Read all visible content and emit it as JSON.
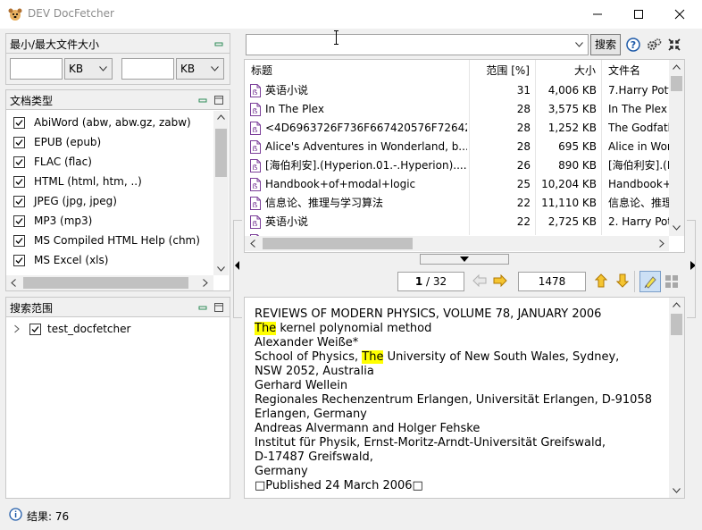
{
  "window": {
    "title": "DEV DocFetcher",
    "icon": "dog-icon"
  },
  "size_panel": {
    "title": "最小/最大文件大小",
    "min_value": "",
    "min_unit": "KB",
    "max_value": "",
    "max_unit": "KB"
  },
  "doctype_panel": {
    "title": "文档类型",
    "items": [
      {
        "label": "AbiWord (abw, abw.gz, zabw)",
        "checked": true
      },
      {
        "label": "EPUB (epub)",
        "checked": true
      },
      {
        "label": "FLAC (flac)",
        "checked": true
      },
      {
        "label": "HTML (html, htm, ..)",
        "checked": true
      },
      {
        "label": "JPEG (jpg, jpeg)",
        "checked": true
      },
      {
        "label": "MP3 (mp3)",
        "checked": true
      },
      {
        "label": "MS Compiled HTML Help (chm)",
        "checked": true
      },
      {
        "label": "MS Excel (xls)",
        "checked": true
      }
    ]
  },
  "scope_panel": {
    "title": "搜索范围",
    "root": {
      "label": "test_docfetcher",
      "checked": true
    }
  },
  "search": {
    "query": "",
    "button_label": "搜索"
  },
  "results": {
    "columns": [
      "标题",
      "范围 [%]",
      "大小",
      "文件名"
    ],
    "rows": [
      {
        "title": "英语小说",
        "score": "31",
        "size": "4,006 KB",
        "filename": "7.Harry Pott"
      },
      {
        "title": "In The Plex",
        "score": "28",
        "size": "3,575 KB",
        "filename": "In The Plex"
      },
      {
        "title": "<4D6963726F736F667420576F72642...",
        "score": "28",
        "size": "1,252 KB",
        "filename": "The Godfath"
      },
      {
        "title": "Alice's Adventures in Wonderland, b...",
        "score": "28",
        "size": "695 KB",
        "filename": "Alice in Wor"
      },
      {
        "title": "[海伯利安].(Hyperion.01.-.Hyperion)....",
        "score": "26",
        "size": "890 KB",
        "filename": "[海伯利安].(H"
      },
      {
        "title": "Handbook+of+modal+logic",
        "score": "25",
        "size": "10,204 KB",
        "filename": "Handbook+"
      },
      {
        "title": "信息论、推理与学习算法",
        "score": "22",
        "size": "11,110 KB",
        "filename": "信息论、推理"
      },
      {
        "title": "英语小说",
        "score": "22",
        "size": "2,725 KB",
        "filename": "2. Harry Pot"
      }
    ]
  },
  "preview_toolbar": {
    "page_current": "1",
    "page_total": "32",
    "occurrences": "1478"
  },
  "preview": {
    "lines": [
      [
        {
          "t": "REVIEWS OF MODERN PHYSICS, VOLUME 78, JANUARY 2006",
          "h": false
        }
      ],
      [
        {
          "t": "The",
          "h": true
        },
        {
          "t": " kernel polynomial method",
          "h": false
        }
      ],
      [
        {
          "t": "Alexander Weiße*",
          "h": false
        }
      ],
      [
        {
          "t": "School of Physics, ",
          "h": false
        },
        {
          "t": "The",
          "h": true
        },
        {
          "t": " University of New South Wales, Sydney,",
          "h": false
        }
      ],
      [
        {
          "t": "NSW 2052, Australia",
          "h": false
        }
      ],
      [
        {
          "t": "Gerhard Wellein",
          "h": false
        }
      ],
      [
        {
          "t": "Regionales Rechenzentrum Erlangen, Universität Erlangen, D-91058",
          "h": false
        }
      ],
      [
        {
          "t": "Erlangen, Germany",
          "h": false
        }
      ],
      [
        {
          "t": "Andreas Alvermann and Holger Fehske",
          "h": false
        }
      ],
      [
        {
          "t": "Institut für Physik, Ernst-Moritz-Arndt-Universität Greifswald,",
          "h": false
        }
      ],
      [
        {
          "t": "D-17487 Greifswald,",
          "h": false
        }
      ],
      [
        {
          "t": "Germany",
          "h": false
        }
      ],
      [
        {
          "t": "□Published 24 March 2006□",
          "h": false
        }
      ]
    ]
  },
  "status": {
    "text": "结果: 76"
  },
  "colors": {
    "highlight": "#ffff00",
    "doc_icon": "#7b3f99",
    "arrow_orange": "#e8a000"
  }
}
